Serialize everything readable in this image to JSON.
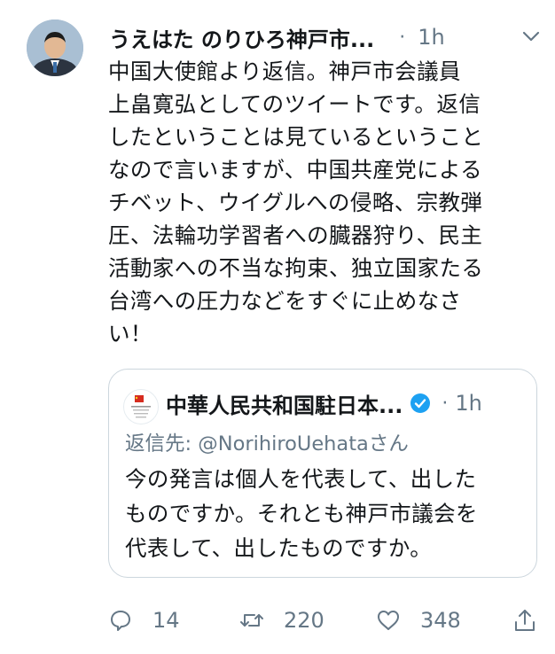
{
  "tweet": {
    "author_name": "うえはた のりひろ神戸市...",
    "separator": "·",
    "time": "1h",
    "text": "中国大使館より返信。神戸市会議員\n上畠寛弘としてのツイートです。返信\nしたということは見ているということ\nなので言いますが、中国共産党による\nチベット、ウイグルへの侵略、宗教弾\n圧、法輪功学習者への臓器狩り、民主\n活動家への不当な拘束、独立国家たる\n台湾への圧力などをすぐに止めなさ\nい！"
  },
  "quoted_tweet": {
    "author_name": "中華人民共和国駐日本...",
    "separator": "·",
    "time": "1h",
    "reply_to": "返信先: @NorihiroUehataさん",
    "text": "今の発言は個人を代表して、出した\nものですか。それとも神戸市議会を\n代表して、出したものですか。"
  },
  "actions": {
    "reply_count": "14",
    "retweet_count": "220",
    "like_count": "348"
  },
  "colors": {
    "secondary_text": "#657786",
    "border": "#ccd6dd",
    "verified_blue": "#1da1f2"
  },
  "icons": [
    "avatar",
    "chevron-down-icon",
    "verified-badge-icon",
    "reply-icon",
    "retweet-icon",
    "like-icon",
    "share-icon"
  ]
}
